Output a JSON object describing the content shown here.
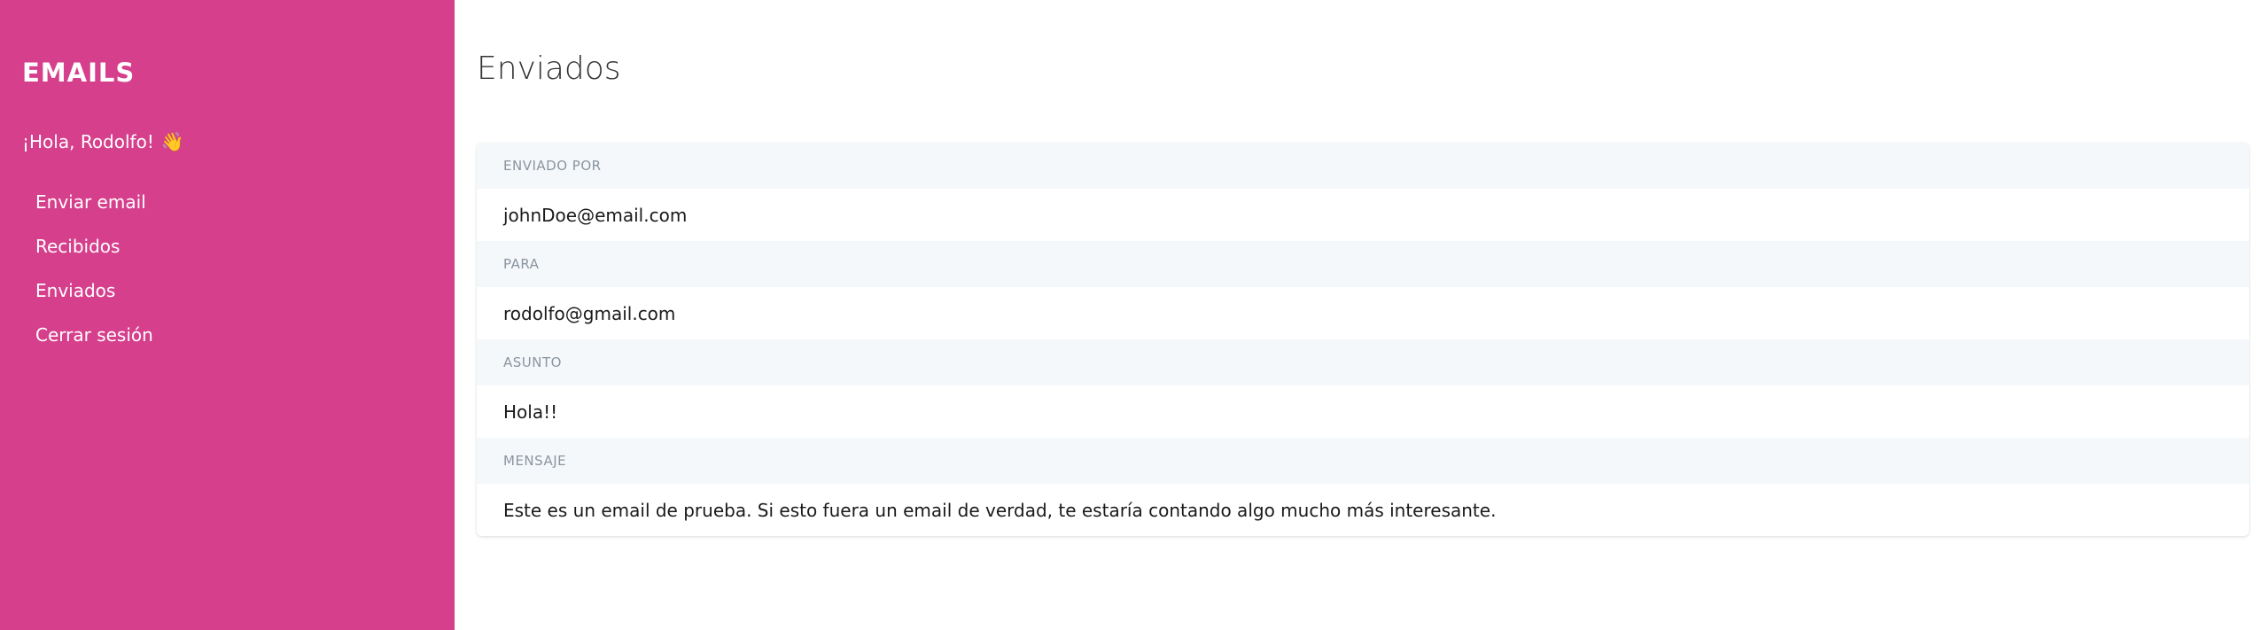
{
  "sidebar": {
    "brand": "EMAILS",
    "greeting": "¡Hola, Rodolfo!",
    "greeting_emoji": "👋",
    "nav": [
      {
        "label": "Enviar email"
      },
      {
        "label": "Recibidos"
      },
      {
        "label": "Enviados"
      },
      {
        "label": "Cerrar sesión"
      }
    ],
    "background_color": "#d63f8c"
  },
  "main": {
    "title": "Enviados",
    "email": {
      "from_label": "ENVIADO POR",
      "from_value": "johnDoe@email.com",
      "to_label": "PARA",
      "to_value": "rodolfo@gmail.com",
      "subject_label": "ASUNTO",
      "subject_value": "Hola!!",
      "message_label": "MENSAJE",
      "message_value": "Este es un email de prueba. Si esto fuera un email de verdad, te estaría contando algo mucho más interesante."
    }
  }
}
